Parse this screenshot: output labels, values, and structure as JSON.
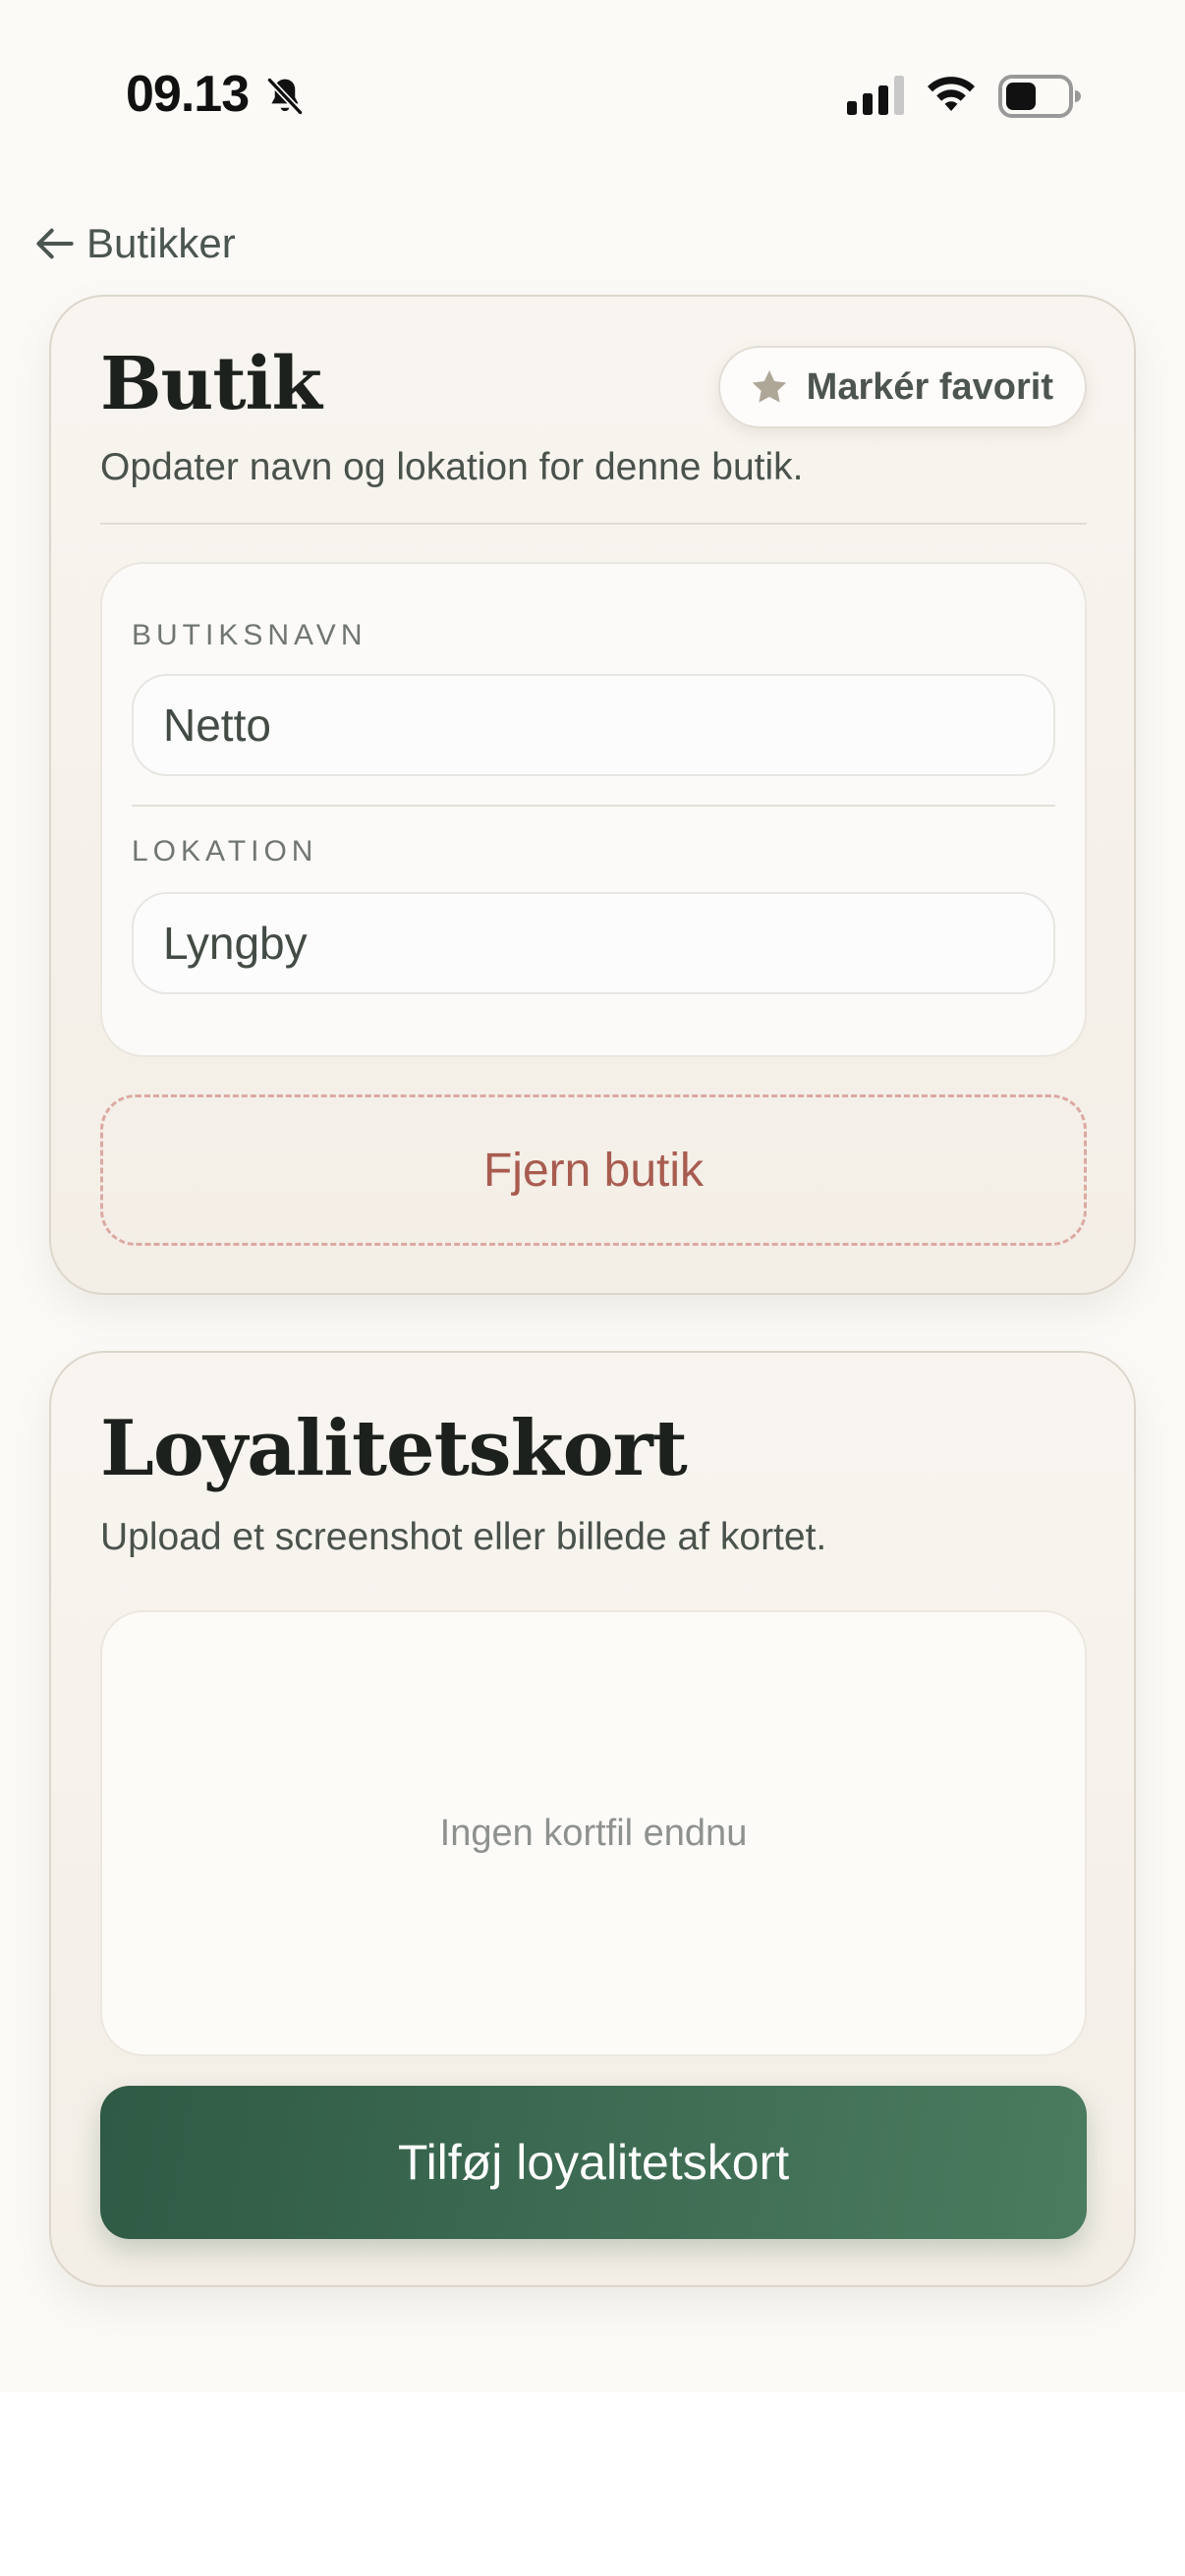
{
  "status_bar": {
    "time": "09.13",
    "icons": [
      "bell-slash-icon",
      "signal-icon",
      "wifi-icon",
      "battery-icon"
    ]
  },
  "nav": {
    "back_label": "Butikker",
    "back_icon": "arrow-left-icon"
  },
  "store_card": {
    "title": "Butik",
    "description": "Opdater navn og lokation for denne butik.",
    "favorite_label": "Markér favorit",
    "favorite_icon": "star-icon",
    "name_label": "BUTIKSNAVN",
    "name_value": "Netto",
    "location_label": "LOKATION",
    "location_value": "Lyngby",
    "remove_label": "Fjern butik"
  },
  "loyalty_card": {
    "title": "Loyalitetskort",
    "description": "Upload et screenshot eller billede af kortet.",
    "empty_text": "Ingen kortfil endnu",
    "add_label": "Tilføj loyalitetskort"
  },
  "colors": {
    "accent_green": "#3d6b53",
    "danger": "#a85c50",
    "background": "#fbfaf7"
  }
}
